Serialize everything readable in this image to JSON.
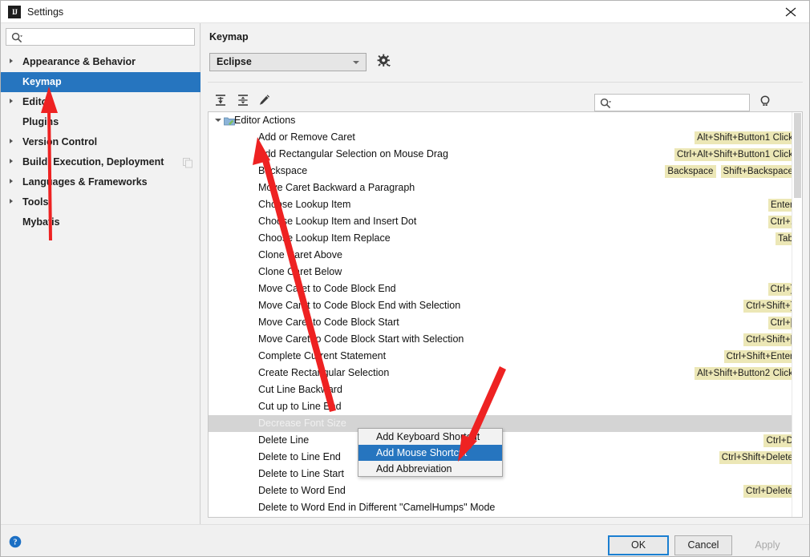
{
  "window": {
    "title": "Settings",
    "app_icon": "intellij-idea-icon",
    "close_icon": "close-icon"
  },
  "sidebar": {
    "search": {
      "placeholder": "",
      "value": "",
      "icon": "search-icon"
    },
    "items": [
      {
        "label": "Appearance & Behavior",
        "expandable": true,
        "selected": false
      },
      {
        "label": "Keymap",
        "expandable": false,
        "selected": true
      },
      {
        "label": "Editor",
        "expandable": true,
        "selected": false
      },
      {
        "label": "Plugins",
        "expandable": false,
        "selected": false
      },
      {
        "label": "Version Control",
        "expandable": true,
        "selected": false
      },
      {
        "label": "Build, Execution, Deployment",
        "expandable": true,
        "selected": false
      },
      {
        "label": "Languages & Frameworks",
        "expandable": true,
        "selected": false
      },
      {
        "label": "Tools",
        "expandable": true,
        "selected": false
      },
      {
        "label": "Mybatis",
        "expandable": false,
        "selected": false
      }
    ],
    "copy_icon": "copy-icon"
  },
  "panel": {
    "title": "Keymap",
    "keymap_select": {
      "value": "Eclipse",
      "icon": "chevron-down-icon"
    },
    "gear_icon": "gear-icon",
    "toolbar": {
      "expand_all_icon": "expand-all-icon",
      "collapse_all_icon": "collapse-all-icon",
      "edit_icon": "pencil-edit-icon"
    },
    "find": {
      "placeholder": "",
      "value": "",
      "icon": "search-icon"
    },
    "find_by_shortcut_icon": "find-by-shortcut-icon"
  },
  "tree": {
    "group": {
      "label": "Editor Actions",
      "icon": "folder-actions-icon",
      "expanded": true
    },
    "rows": [
      {
        "label": "Add or Remove Caret",
        "shortcuts": [
          "Alt+Shift+Button1 Click"
        ]
      },
      {
        "label": "Add Rectangular Selection on Mouse Drag",
        "shortcuts": [
          "Ctrl+Alt+Shift+Button1 Click"
        ]
      },
      {
        "label": "Backspace",
        "shortcuts": [
          "Backspace",
          "Shift+Backspace"
        ]
      },
      {
        "label": "Move Caret Backward a Paragraph",
        "shortcuts": []
      },
      {
        "label": "Choose Lookup Item",
        "shortcuts": [
          "Enter"
        ]
      },
      {
        "label": "Choose Lookup Item and Insert Dot",
        "shortcuts": [
          "Ctrl+."
        ]
      },
      {
        "label": "Choose Lookup Item Replace",
        "shortcuts": [
          "Tab"
        ]
      },
      {
        "label": "Clone Caret Above",
        "shortcuts": []
      },
      {
        "label": "Clone Caret Below",
        "shortcuts": []
      },
      {
        "label": "Move Caret to Code Block End",
        "shortcuts": [
          "Ctrl+]"
        ]
      },
      {
        "label": "Move Caret to Code Block End with Selection",
        "shortcuts": [
          "Ctrl+Shift+]"
        ]
      },
      {
        "label": "Move Caret to Code Block Start",
        "shortcuts": [
          "Ctrl+["
        ]
      },
      {
        "label": "Move Caret to Code Block Start with Selection",
        "shortcuts": [
          "Ctrl+Shift+["
        ]
      },
      {
        "label": "Complete Current Statement",
        "shortcuts": [
          "Ctrl+Shift+Enter"
        ]
      },
      {
        "label": "Create Rectangular Selection",
        "shortcuts": [
          "Alt+Shift+Button2 Click"
        ]
      },
      {
        "label": "Cut Line Backward",
        "shortcuts": []
      },
      {
        "label": "Cut up to Line End",
        "shortcuts": []
      },
      {
        "label": "Decrease Font Size",
        "shortcuts": [],
        "selected": true
      },
      {
        "label": "Delete Line",
        "shortcuts": [
          "Ctrl+D"
        ]
      },
      {
        "label": "Delete to Line End",
        "shortcuts": [
          "Ctrl+Shift+Delete"
        ]
      },
      {
        "label": "Delete to Line Start",
        "shortcuts": []
      },
      {
        "label": "Delete to Word End",
        "shortcuts": [
          "Ctrl+Delete"
        ]
      },
      {
        "label": "Delete to Word End in Different \"CamelHumps\" Mode",
        "shortcuts": []
      }
    ]
  },
  "context_menu": {
    "items": [
      {
        "label": "Add Keyboard Shortcut",
        "highlighted": false
      },
      {
        "label": "Add Mouse Shortcut",
        "highlighted": true
      },
      {
        "label": "Add Abbreviation",
        "highlighted": false
      }
    ]
  },
  "footer": {
    "help_icon": "help-icon",
    "ok_label": "OK",
    "cancel_label": "Cancel",
    "apply_label": "Apply",
    "apply_disabled": true
  },
  "annotations": {
    "color": "#ee2222",
    "arrows": [
      {
        "name": "arrow-to-keymap"
      },
      {
        "name": "arrow-to-add-or-remove-caret"
      },
      {
        "name": "arrow-to-add-mouse-shortcut"
      }
    ]
  }
}
